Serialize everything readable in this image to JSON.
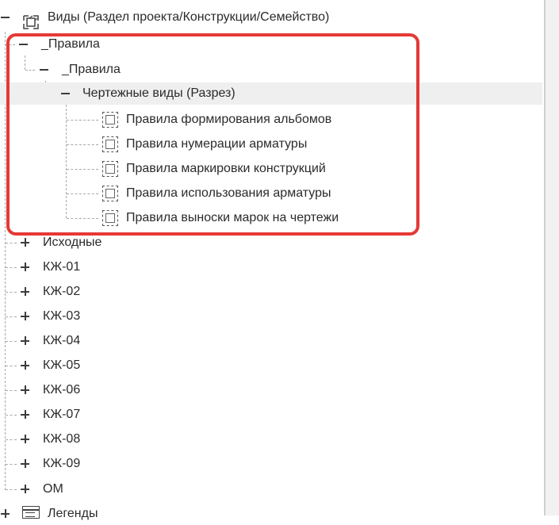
{
  "tree": {
    "root_label": "Виды (Раздел проекта/Конструкции/Семейство)",
    "rules_group": {
      "label": "_Правила",
      "child": {
        "label": "_Правила",
        "child": {
          "label": "Чертежные виды (Разрез)",
          "items": [
            "Правила формирования альбомов",
            "Правила нумерации арматуры",
            "Правила маркировки конструкций",
            "Правила использования арматуры",
            "Правила выноски марок на чертежи"
          ]
        }
      }
    },
    "groups": [
      "Исходные",
      "КЖ-01",
      "КЖ-02",
      "КЖ-03",
      "КЖ-04",
      "КЖ-05",
      "КЖ-06",
      "КЖ-07",
      "КЖ-08",
      "КЖ-09",
      "ОМ"
    ],
    "legends_label": "Легенды"
  },
  "colors": {
    "highlight": "#e53935",
    "selected_row": "#efefef",
    "text": "#2b2b2b"
  }
}
